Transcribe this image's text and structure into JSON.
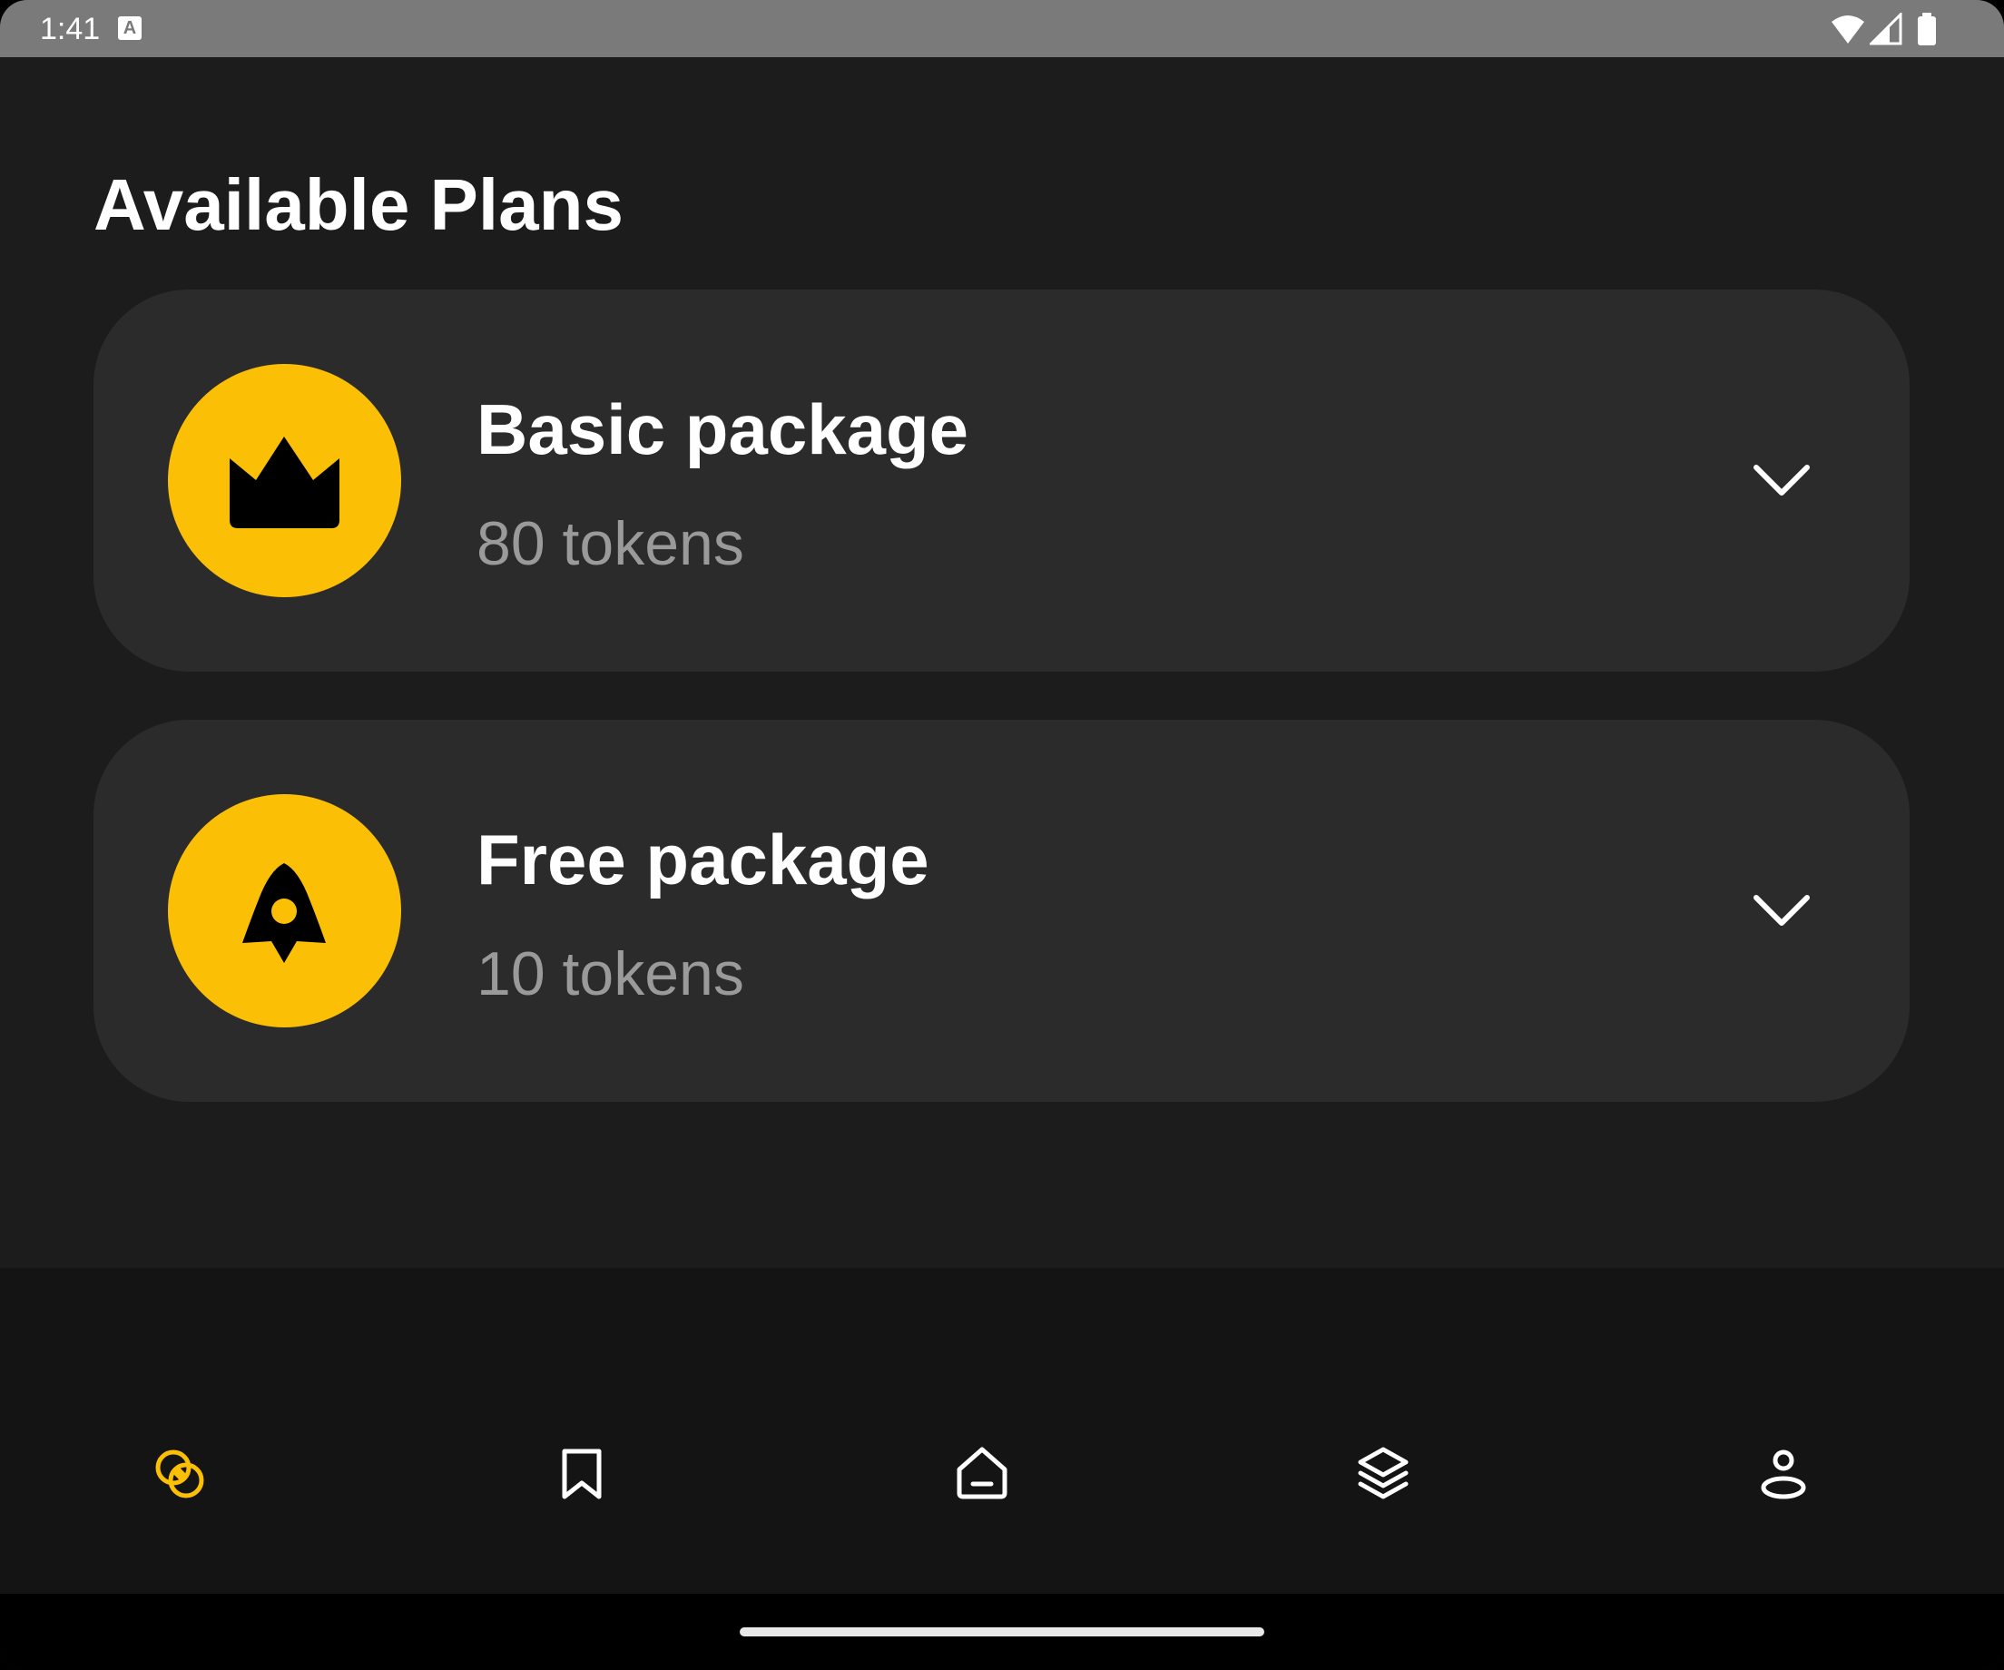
{
  "status_bar": {
    "time": "1:41",
    "notification_icon_letter": "A",
    "icons": [
      "wifi-icon",
      "signal-icon",
      "battery-icon"
    ]
  },
  "page": {
    "title": "Available Plans"
  },
  "plans": [
    {
      "name": "Basic package",
      "tokens": "80 tokens",
      "icon": "crown-icon"
    },
    {
      "name": "Free package",
      "tokens": "10 tokens",
      "icon": "rocket-icon"
    }
  ],
  "bottom_nav": {
    "items": [
      {
        "icon": "plans-icon",
        "active": true
      },
      {
        "icon": "bookmark-icon",
        "active": false
      },
      {
        "icon": "home-icon",
        "active": false
      },
      {
        "icon": "layers-icon",
        "active": false
      },
      {
        "icon": "profile-icon",
        "active": false
      }
    ]
  },
  "colors": {
    "background": "#1c1c1c",
    "card": "#2b2b2b",
    "accent": "#fbbf06",
    "nav_background": "#141414",
    "secondary_text": "#9a9a9a"
  }
}
